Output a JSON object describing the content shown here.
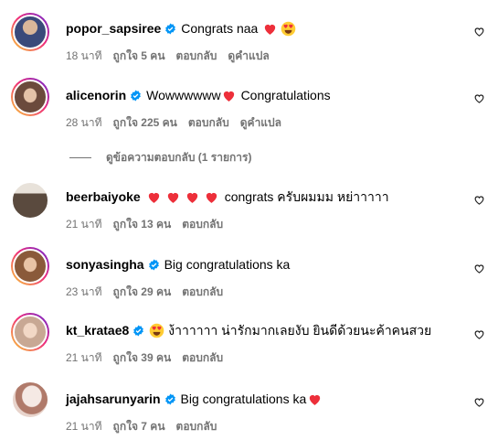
{
  "comments": [
    {
      "username": "popor_sapsiree",
      "text": "Congrats naa",
      "emojis": [
        "red-heart",
        "heart-eyes-face"
      ],
      "time": "18 นาที",
      "likes": "ถูกใจ 5 คน",
      "reply": "ตอบกลับ",
      "translate": "ดูคำแปล",
      "avatar_color": "#3a4a7a"
    },
    {
      "username": "alicenorin",
      "text": "Wowwwwww",
      "text_after": "Congratulations",
      "emojis": [
        "red-heart"
      ],
      "time": "28 นาที",
      "likes": "ถูกใจ 225 คน",
      "reply": "ตอบกลับ",
      "translate": "ดูคำแปล",
      "avatar_color": "#6b4a3c",
      "view_replies": "ดูข้อความตอบกลับ (1 รายการ)"
    },
    {
      "username": "beerbaiyoke",
      "emojis": [
        "red-heart",
        "red-heart",
        "red-heart",
        "red-heart"
      ],
      "text": "congrats ครับผมมม หย่าาาาา",
      "time": "21 นาที",
      "likes": "ถูกใจ 13 คน",
      "reply": "ตอบกลับ",
      "avatar_color": "#5a4a3e"
    },
    {
      "username": "sonyasingha",
      "text": "Big congratulations ka",
      "time": "23 นาที",
      "likes": "ถูกใจ 29 คน",
      "reply": "ตอบกลับ",
      "avatar_color": "#8a5a3a"
    },
    {
      "username": "kt_kratae8",
      "emojis": [
        "heart-eyes-face"
      ],
      "text": "ง้าาาาาา น่ารักมากเลยงับ ยินดีด้วยนะค้าคนสวย",
      "time": "21 นาที",
      "likes": "ถูกใจ 39 คน",
      "reply": "ตอบกลับ",
      "avatar_color": "#c8a894"
    },
    {
      "username": "jajahsarunyarin",
      "text": "Big congratulations ka",
      "emojis": [
        "red-heart"
      ],
      "time": "21 นาที",
      "likes": "ถูกใจ 7 คน",
      "reply": "ตอบกลับ",
      "avatar_color": "#b07a6a"
    }
  ],
  "colors": {
    "verified": "#0095f6",
    "meta": "#737373",
    "heart": "#ed2f3a",
    "emoji_face": "#ffcc33"
  }
}
